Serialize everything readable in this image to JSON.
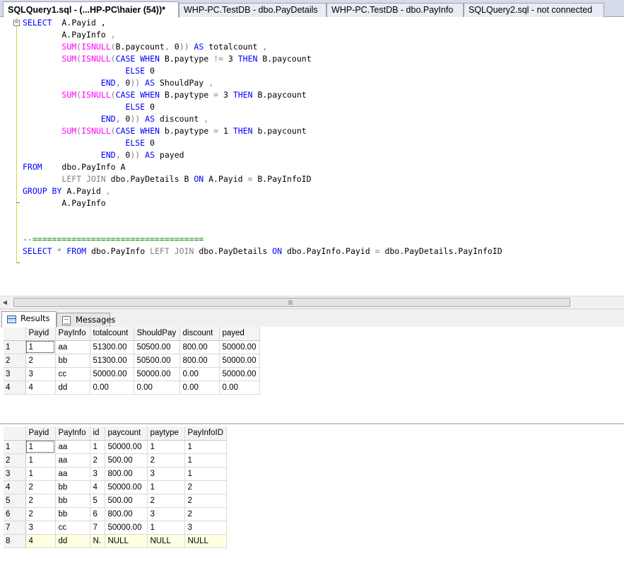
{
  "tabs": [
    {
      "label": "SQLQuery1.sql - (...HP-PC\\haier (54))*",
      "active": true
    },
    {
      "label": "WHP-PC.TestDB - dbo.PayDetails",
      "active": false
    },
    {
      "label": "WHP-PC.TestDB - dbo.PayInfo",
      "active": false
    },
    {
      "label": "SQLQuery2.sql - not connected",
      "active": false
    }
  ],
  "editor": {
    "collapse_glyph": "−",
    "scroll_left_glyph": "◀",
    "scroll_grip_glyph": "lll",
    "lines": [
      [
        {
          "t": "SELECT",
          "c": "kw"
        },
        {
          "t": "  A.Payid ,",
          "c": ""
        }
      ],
      [
        {
          "t": "        A.PayInfo ",
          "c": ""
        },
        {
          "t": ",",
          "c": "gr"
        }
      ],
      [
        {
          "t": "        ",
          "c": ""
        },
        {
          "t": "SUM",
          "c": "fn"
        },
        {
          "t": "(",
          "c": "gr"
        },
        {
          "t": "ISNULL",
          "c": "fn"
        },
        {
          "t": "(",
          "c": "gr"
        },
        {
          "t": "B.paycount",
          "c": ""
        },
        {
          "t": ", ",
          "c": "gr"
        },
        {
          "t": "0",
          "c": ""
        },
        {
          "t": ")) ",
          "c": "gr"
        },
        {
          "t": "AS",
          "c": "kw"
        },
        {
          "t": " totalcount ",
          "c": ""
        },
        {
          "t": ",",
          "c": "gr"
        }
      ],
      [
        {
          "t": "        ",
          "c": ""
        },
        {
          "t": "SUM",
          "c": "fn"
        },
        {
          "t": "(",
          "c": "gr"
        },
        {
          "t": "ISNULL",
          "c": "fn"
        },
        {
          "t": "(",
          "c": "gr"
        },
        {
          "t": "CASE",
          "c": "kw"
        },
        {
          "t": " ",
          "c": ""
        },
        {
          "t": "WHEN",
          "c": "kw"
        },
        {
          "t": " B.paytype ",
          "c": ""
        },
        {
          "t": "!=",
          "c": "gr"
        },
        {
          "t": " 3 ",
          "c": ""
        },
        {
          "t": "THEN",
          "c": "kw"
        },
        {
          "t": " B.paycount",
          "c": ""
        }
      ],
      [
        {
          "t": "                     ",
          "c": ""
        },
        {
          "t": "ELSE",
          "c": "kw"
        },
        {
          "t": " 0",
          "c": ""
        }
      ],
      [
        {
          "t": "                ",
          "c": ""
        },
        {
          "t": "END",
          "c": "kw"
        },
        {
          "t": ", ",
          "c": "gr"
        },
        {
          "t": "0",
          "c": ""
        },
        {
          "t": ")) ",
          "c": "gr"
        },
        {
          "t": "AS",
          "c": "kw"
        },
        {
          "t": " ShouldPay ",
          "c": ""
        },
        {
          "t": ",",
          "c": "gr"
        }
      ],
      [
        {
          "t": "        ",
          "c": ""
        },
        {
          "t": "SUM",
          "c": "fn"
        },
        {
          "t": "(",
          "c": "gr"
        },
        {
          "t": "ISNULL",
          "c": "fn"
        },
        {
          "t": "(",
          "c": "gr"
        },
        {
          "t": "CASE",
          "c": "kw"
        },
        {
          "t": " ",
          "c": ""
        },
        {
          "t": "WHEN",
          "c": "kw"
        },
        {
          "t": " B.paytype ",
          "c": ""
        },
        {
          "t": "=",
          "c": "gr"
        },
        {
          "t": " 3 ",
          "c": ""
        },
        {
          "t": "THEN",
          "c": "kw"
        },
        {
          "t": " B.paycount",
          "c": ""
        }
      ],
      [
        {
          "t": "                     ",
          "c": ""
        },
        {
          "t": "ELSE",
          "c": "kw"
        },
        {
          "t": " 0",
          "c": ""
        }
      ],
      [
        {
          "t": "                ",
          "c": ""
        },
        {
          "t": "END",
          "c": "kw"
        },
        {
          "t": ", ",
          "c": "gr"
        },
        {
          "t": "0",
          "c": ""
        },
        {
          "t": ")) ",
          "c": "gr"
        },
        {
          "t": "AS",
          "c": "kw"
        },
        {
          "t": " discount ",
          "c": ""
        },
        {
          "t": ",",
          "c": "gr"
        }
      ],
      [
        {
          "t": "        ",
          "c": ""
        },
        {
          "t": "SUM",
          "c": "fn"
        },
        {
          "t": "(",
          "c": "gr"
        },
        {
          "t": "ISNULL",
          "c": "fn"
        },
        {
          "t": "(",
          "c": "gr"
        },
        {
          "t": "CASE",
          "c": "kw"
        },
        {
          "t": " ",
          "c": ""
        },
        {
          "t": "WHEN",
          "c": "kw"
        },
        {
          "t": " b.paytype ",
          "c": ""
        },
        {
          "t": "=",
          "c": "gr"
        },
        {
          "t": " 1 ",
          "c": ""
        },
        {
          "t": "THEN",
          "c": "kw"
        },
        {
          "t": " b.paycount",
          "c": ""
        }
      ],
      [
        {
          "t": "                     ",
          "c": ""
        },
        {
          "t": "ELSE",
          "c": "kw"
        },
        {
          "t": " 0",
          "c": ""
        }
      ],
      [
        {
          "t": "                ",
          "c": ""
        },
        {
          "t": "END",
          "c": "kw"
        },
        {
          "t": ", ",
          "c": "gr"
        },
        {
          "t": "0",
          "c": ""
        },
        {
          "t": ")) ",
          "c": "gr"
        },
        {
          "t": "AS",
          "c": "kw"
        },
        {
          "t": " payed",
          "c": ""
        }
      ],
      [
        {
          "t": "FROM",
          "c": "kw"
        },
        {
          "t": "    dbo.PayInfo A",
          "c": ""
        }
      ],
      [
        {
          "t": "        ",
          "c": ""
        },
        {
          "t": "LEFT JOIN",
          "c": "gr"
        },
        {
          "t": " dbo.PayDetails B ",
          "c": ""
        },
        {
          "t": "ON",
          "c": "kw"
        },
        {
          "t": " A.Payid ",
          "c": ""
        },
        {
          "t": "=",
          "c": "gr"
        },
        {
          "t": " B.PayInfoID",
          "c": ""
        }
      ],
      [
        {
          "t": "GROUP BY",
          "c": "kw"
        },
        {
          "t": " A.Payid ",
          "c": ""
        },
        {
          "t": ",",
          "c": "gr"
        }
      ],
      [
        {
          "t": "        A.PayInfo",
          "c": ""
        }
      ],
      [
        {
          "t": "",
          "c": ""
        }
      ],
      [
        {
          "t": "",
          "c": ""
        }
      ],
      [
        {
          "t": "--===================================",
          "c": "cm"
        }
      ],
      [
        {
          "t": "SELECT",
          "c": "kw"
        },
        {
          "t": " ",
          "c": ""
        },
        {
          "t": "*",
          "c": "gr"
        },
        {
          "t": " ",
          "c": ""
        },
        {
          "t": "FROM",
          "c": "kw"
        },
        {
          "t": " dbo.PayInfo ",
          "c": ""
        },
        {
          "t": "LEFT JOIN",
          "c": "gr"
        },
        {
          "t": " dbo.PayDetails ",
          "c": ""
        },
        {
          "t": "ON",
          "c": "kw"
        },
        {
          "t": " dbo.PayInfo.Payid ",
          "c": ""
        },
        {
          "t": "=",
          "c": "gr"
        },
        {
          "t": " dbo.PayDetails.PayInfoID",
          "c": ""
        }
      ]
    ]
  },
  "results_tabs": {
    "results": "Results",
    "messages": "Messages"
  },
  "grid1": {
    "columns": [
      "Payid",
      "PayInfo",
      "totalcount",
      "ShouldPay",
      "discount",
      "payed"
    ],
    "rows": [
      [
        "1",
        "1",
        "aa",
        "51300.00",
        "50500.00",
        "800.00",
        "50000.00"
      ],
      [
        "2",
        "2",
        "bb",
        "51300.00",
        "50500.00",
        "800.00",
        "50000.00"
      ],
      [
        "3",
        "3",
        "cc",
        "50000.00",
        "50000.00",
        "0.00",
        "50000.00"
      ],
      [
        "4",
        "4",
        "dd",
        "0.00",
        "0.00",
        "0.00",
        "0.00"
      ]
    ]
  },
  "grid2": {
    "columns": [
      "Payid",
      "PayInfo",
      "id",
      "paycount",
      "paytype",
      "PayInfoID"
    ],
    "rows": [
      [
        "1",
        "1",
        "aa",
        "1",
        "50000.00",
        "1",
        "1"
      ],
      [
        "2",
        "1",
        "aa",
        "2",
        "500.00",
        "2",
        "1"
      ],
      [
        "3",
        "1",
        "aa",
        "3",
        "800.00",
        "3",
        "1"
      ],
      [
        "4",
        "2",
        "bb",
        "4",
        "50000.00",
        "1",
        "2"
      ],
      [
        "5",
        "2",
        "bb",
        "5",
        "500.00",
        "2",
        "2"
      ],
      [
        "6",
        "2",
        "bb",
        "6",
        "800.00",
        "3",
        "2"
      ],
      [
        "7",
        "3",
        "cc",
        "7",
        "50000.00",
        "1",
        "3"
      ],
      [
        "8",
        "4",
        "dd",
        "N.",
        "NULL",
        "NULL",
        "NULL"
      ]
    ]
  }
}
